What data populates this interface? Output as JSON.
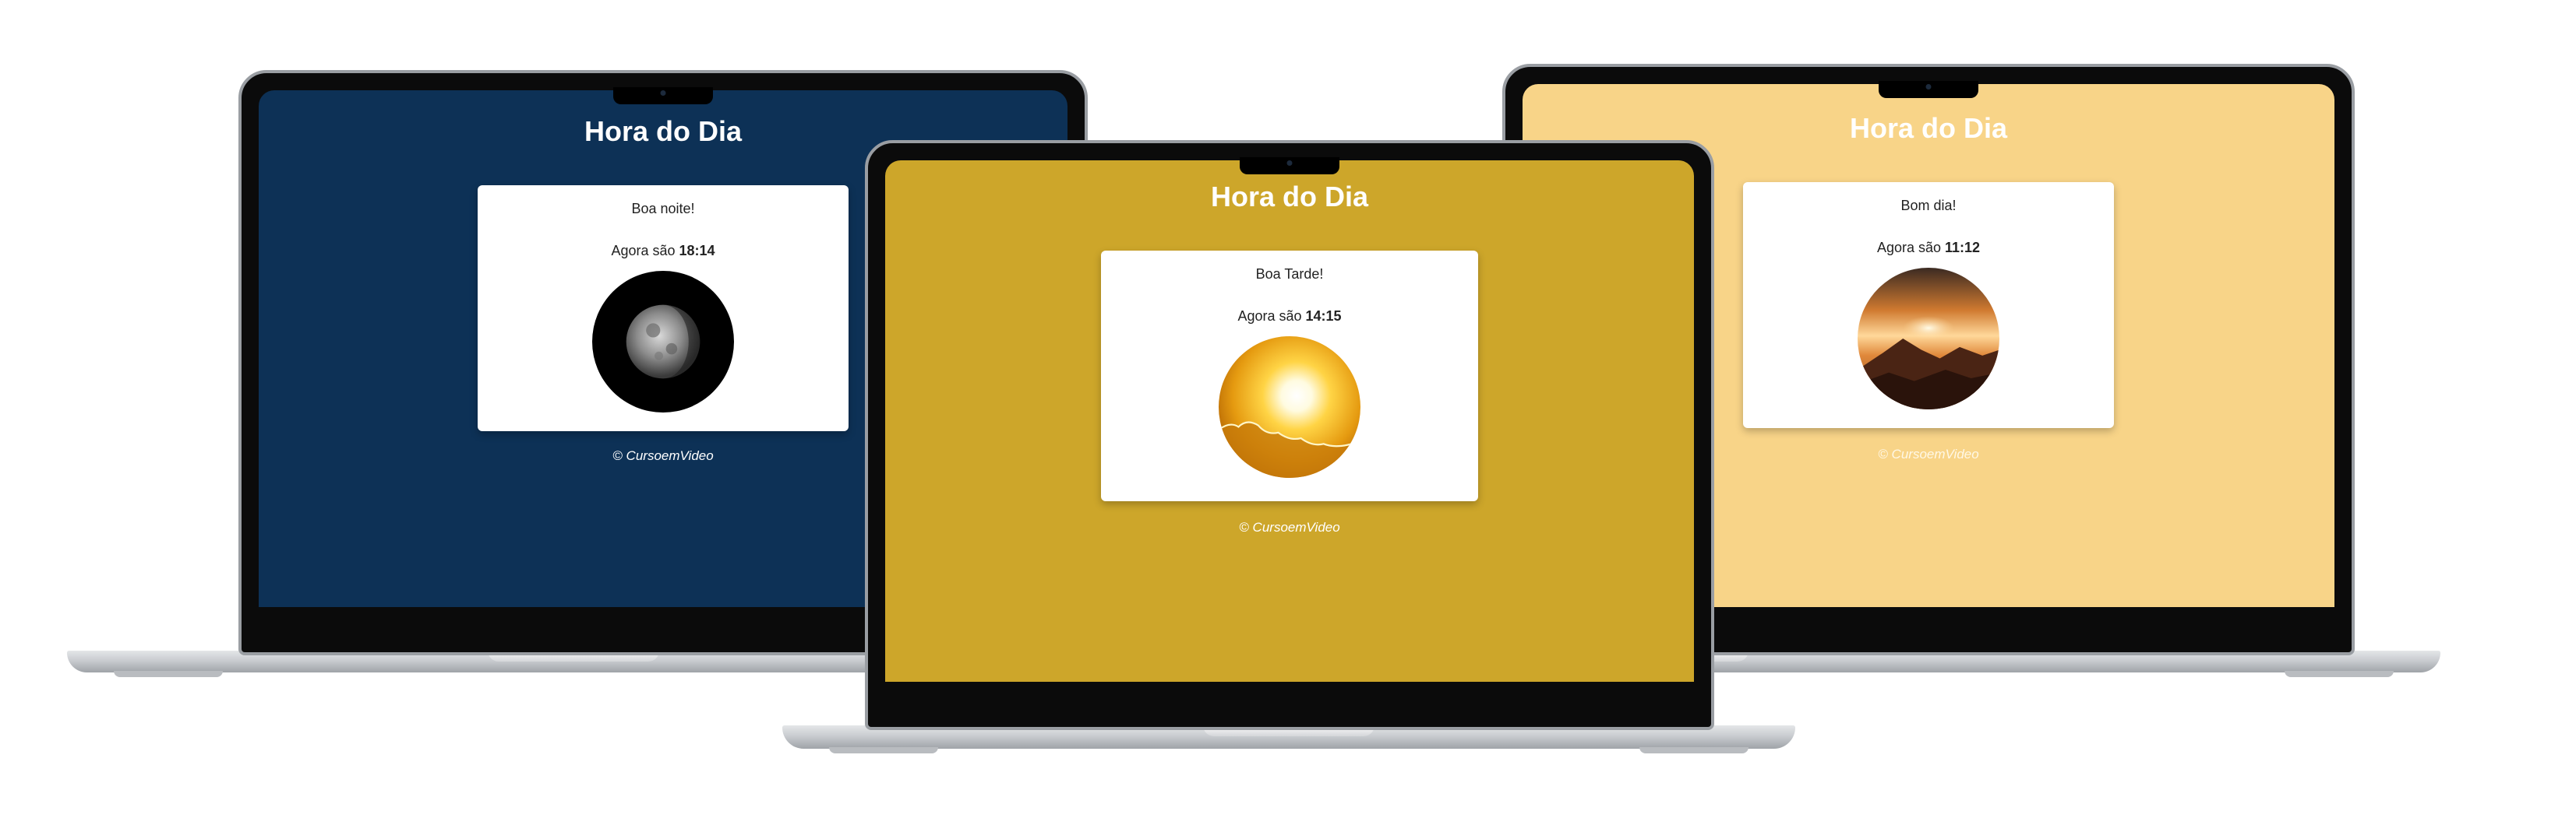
{
  "laptops": [
    {
      "screen_color": "#0d3156",
      "title": "Hora do Dia",
      "greeting": "Boa noite!",
      "time_prefix": "Agora são",
      "time": "18:14",
      "image": "moon-photo",
      "footer": "© CursoemVideo"
    },
    {
      "screen_color": "#cda62a",
      "title": "Hora do Dia",
      "greeting": "Boa Tarde!",
      "time_prefix": "Agora são",
      "time": "14:15",
      "image": "sun-photo",
      "footer": "© CursoemVideo"
    },
    {
      "screen_color": "#f8d488",
      "title": "Hora do Dia",
      "greeting": "Bom dia!",
      "time_prefix": "Agora são",
      "time": "11:12",
      "image": "sunrise-photo",
      "footer": "© CursoemVideo"
    }
  ]
}
